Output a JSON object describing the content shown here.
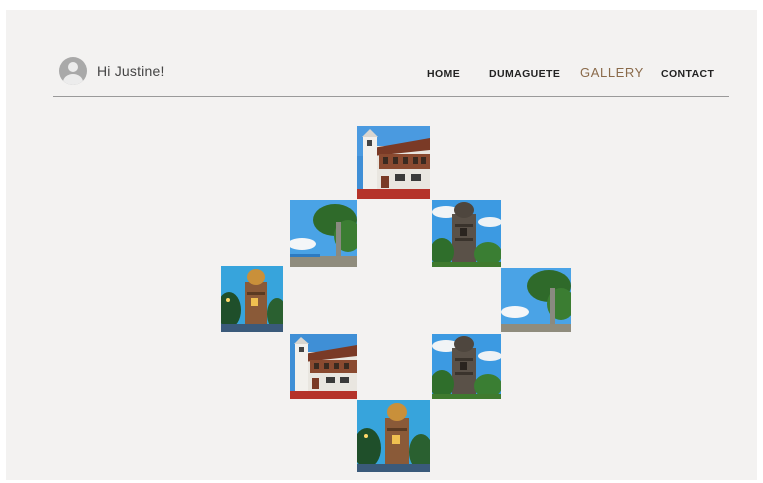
{
  "header": {
    "greeting": "Hi Justine!"
  },
  "nav": {
    "items": [
      {
        "label": "HOME"
      },
      {
        "label": "DUMAGUETE"
      },
      {
        "label": "GALLERY",
        "active": true
      },
      {
        "label": "CONTACT"
      }
    ]
  },
  "gallery": {
    "photos": [
      {
        "subject": "church",
        "index": 1
      },
      {
        "subject": "tree-pillar",
        "index": 2
      },
      {
        "subject": "bell-tower-day",
        "index": 3
      },
      {
        "subject": "bell-tower-night",
        "index": 4
      },
      {
        "subject": "tree-pillar",
        "index": 5
      },
      {
        "subject": "church",
        "index": 6
      },
      {
        "subject": "bell-tower-day",
        "index": 7
      },
      {
        "subject": "bell-tower-night",
        "index": 8
      }
    ]
  },
  "colors": {
    "background": "#f3f2f1",
    "accent": "#8a6a4a",
    "nav_text": "#222222"
  }
}
